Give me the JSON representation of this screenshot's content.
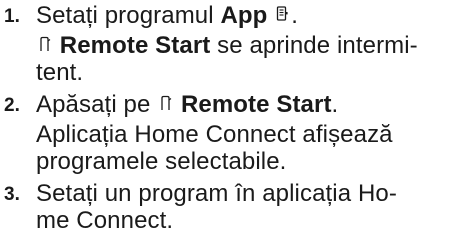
{
  "steps": [
    {
      "number": "1.",
      "text_before": "Setați programul ",
      "bold": "App",
      "icon": "app-program-icon",
      "sub_bold": "Remote Start",
      "sub_icon": "remote-start-icon",
      "sub_line1": " se aprinde intermi-",
      "sub_line2": "tent."
    },
    {
      "number": "2.",
      "text_before": "Apăsați pe ",
      "icon": "remote-start-icon",
      "bold": "Remote Start",
      "period": ".",
      "sub_line1": "Aplicația Home Connect afișează",
      "sub_line2": "programele selectabile."
    },
    {
      "number": "3.",
      "line1": "Setați un program în aplicația Ho-",
      "line2": "me Connect."
    }
  ]
}
